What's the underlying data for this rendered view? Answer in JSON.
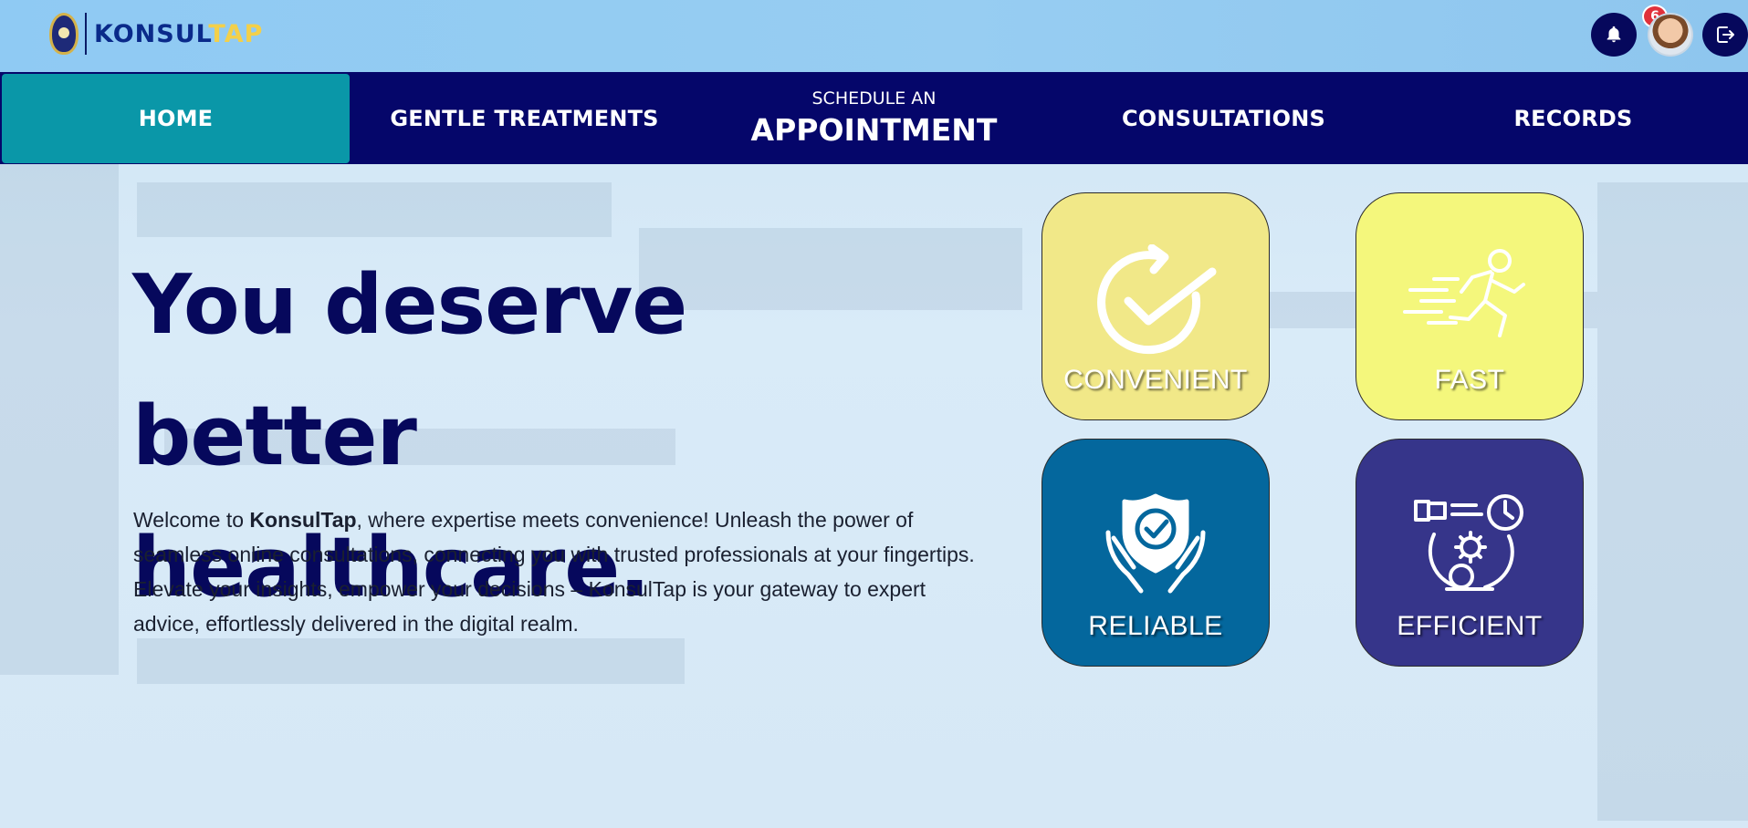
{
  "brand": {
    "part1": "KONSUL",
    "part2": "TAP"
  },
  "notifications": {
    "count": "6"
  },
  "nav": {
    "home": "HOME",
    "gentle": "GENTLE TREATMENTS",
    "schedule_small": "SCHEDULE AN",
    "schedule_big": "APPOINTMENT",
    "consultations": "CONSULTATIONS",
    "records": "RECORDS"
  },
  "hero": {
    "title_line1": "You deserve better",
    "title_line2": "healthcare.",
    "intro_prefix": "Welcome to ",
    "intro_brand": "KonsulTap",
    "intro_rest": ", where expertise meets convenience! Unleash the power of seamless online consultations, connecting you with trusted professionals at your fingertips. Elevate your insights, empower your decisions – KonsulTap is your gateway to expert advice, effortlessly delivered in the digital realm."
  },
  "features": {
    "convenient": "CONVENIENT",
    "fast": "FAST",
    "reliable": "RELIABLE",
    "efficient": "EFFICIENT"
  },
  "icons": [
    "bell-icon",
    "logout-icon",
    "check-cycle-icon",
    "running-person-icon",
    "shield-hands-icon",
    "gear-clock-icon"
  ],
  "colors": {
    "nav": "#05066a",
    "active": "#0a97a8",
    "title": "#06085c"
  }
}
